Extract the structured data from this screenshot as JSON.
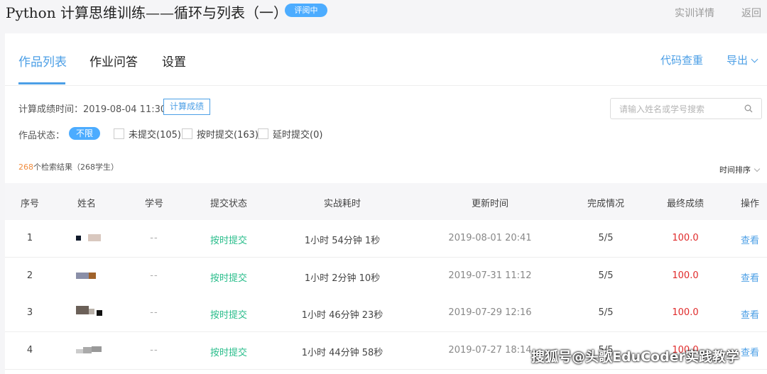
{
  "header": {
    "course_title": "Python 计算思维训练——循环与列表（一）",
    "status_badge": "评阅中",
    "training_details": "实训详情",
    "back": "返回"
  },
  "tabs": [
    {
      "label": "作品列表",
      "active": true
    },
    {
      "label": "作业问答",
      "active": false
    },
    {
      "label": "设置",
      "active": false
    }
  ],
  "actions": {
    "code_check": "代码查重",
    "export": "导出"
  },
  "filters": {
    "calc_time_label": "计算成绩时间：2019-08-04 11:30",
    "calc_button": "计算成绩",
    "search_placeholder": "请输入姓名或学号搜索",
    "status_label": "作品状态：",
    "all": "不限",
    "options": [
      {
        "label": "未提交(105)"
      },
      {
        "label": "按时提交(163)"
      },
      {
        "label": "延时提交(0)"
      }
    ]
  },
  "results": {
    "count": "268",
    "suffix": "个检索结果（268学生）",
    "sort_label": "时间排序"
  },
  "table": {
    "headers": [
      "序号",
      "姓名",
      "学号",
      "提交状态",
      "实战耗时",
      "更新时间",
      "完成情况",
      "最终成绩",
      "操作"
    ],
    "rows": [
      {
        "index": "1",
        "student_id": "--",
        "status": "按时提交",
        "duration": "1小时 54分钟 1秒",
        "updated": "2019-08-01 20:41",
        "progress": "5/5",
        "score": "100.0",
        "action": "查看"
      },
      {
        "index": "2",
        "student_id": "--",
        "status": "按时提交",
        "duration": "1小时 2分钟 10秒",
        "updated": "2019-07-31 11:12",
        "progress": "5/5",
        "score": "100.0",
        "action": "查看"
      },
      {
        "index": "3",
        "student_id": "--",
        "status": "按时提交",
        "duration": "1小时 46分钟 23秒",
        "updated": "2019-07-29 12:16",
        "progress": "5/5",
        "score": "100.0",
        "action": "查看"
      },
      {
        "index": "4",
        "student_id": "--",
        "status": "按时提交",
        "duration": "1小时 44分钟 58秒",
        "updated": "2019-07-27 18:14",
        "progress": "5/5",
        "score": "100.0",
        "action": "查看"
      }
    ]
  },
  "watermark": "搜狐号@头歌EduCoder实践教学",
  "colors": {
    "accent": "#4c9fe6",
    "status_green": "#29bd8b",
    "score_red": "#e02a2a",
    "count_orange": "#f08c3e"
  }
}
